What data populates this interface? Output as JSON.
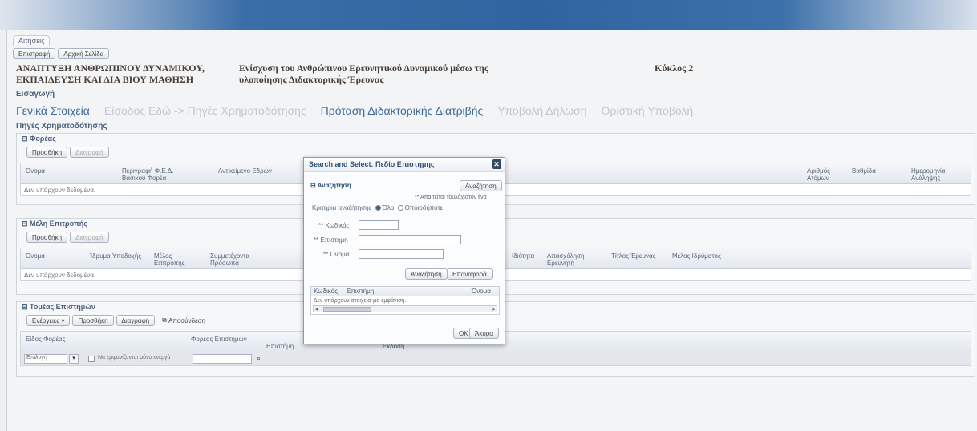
{
  "breadcrumb": {
    "tab": "Αιτήσεις"
  },
  "toolbar": {
    "btn1": "Επιστροφή",
    "btn2": "Αρχική Σελίδα"
  },
  "project": {
    "title": "ΑΝΑΠΤΥΞΗ ΑΝΘΡΩΠΙΝΟΥ ΔΥΝΑΜΙΚΟΥ, ΕΚΠΑΙΔΕΥΣΗ ΚΑΙ ΔΙΑ ΒΙΟΥ ΜΑΘΗΣΗ",
    "subtitle": "Ενίσχυση του Ανθρώπινου Ερευνητικού Δυναμικού μέσω της υλοποίησης Διδακτορικής Έρευνας",
    "code": "Κύκλος 2"
  },
  "intro_label": "Εισαγωγή",
  "steps": [
    {
      "label": "Γενικά Στοιχεία",
      "done": true
    },
    {
      "label": "Είσοδος Εδώ -> Πηγές Χρηματοδότησης",
      "done": false
    },
    {
      "label": "Πρόταση Διδακτορικής Διατριβής",
      "done": true
    },
    {
      "label": "Υποβολή Δήλωση",
      "done": false
    },
    {
      "label": "Οριστική Υποβολή",
      "done": false
    }
  ],
  "funding_title": "Πηγές Χρηματοδότησης",
  "section1": {
    "header": "Φορέας",
    "btn_add": "Προσθήκη",
    "btn_del": "Διαγραφή",
    "cols": [
      "Όνομα",
      "Περιγραφή Φ.Ε.Δ. Βασικού Φορέα",
      "Αντικείμενο Εδρών"
    ],
    "cols_right": [
      "Αριθμός Ατόμων",
      "Βαθμίδα",
      "Ημερομηνία Ανάληψης"
    ],
    "empty": "Δεν υπάρχουν δεδομένα."
  },
  "section2": {
    "header": "Μέλη Επιτροπής",
    "btn_add": "Προσθήκη",
    "btn_del": "Διαγραφή",
    "cols": [
      "Όνομα",
      "Ίδρυμα Υποδοχής",
      "Μέλος Επιτροπής",
      "Συμμετέχοντα Πρόσωπα"
    ],
    "cols_right": [
      "Ιδιότητα",
      "Απασχόληση Ερευνητή",
      "Τίτλος Έρευνας",
      "Μέλος Ιδρύματος"
    ],
    "empty": "Δεν υπάρχουν δεδομένα."
  },
  "section3": {
    "header": "Τομέας Επιστημών",
    "btn_actions": "Ενέργειες",
    "btn_add": "Προσθήκη",
    "btn_del": "Διαγραφή",
    "btn_detach": "Αποσύνδεση",
    "cols": [
      "Είδος Φορέας",
      "Φορέας Επιστημών",
      "Επιστήμη",
      "Έκδοση"
    ],
    "select_value": "Επιλογή",
    "checkbox_label": "Να εμφανίζονται μόνο ενεργά"
  },
  "modal": {
    "title": "Search and Select: Πεδίο Επιστήμης",
    "search_header": "Αναζήτηση",
    "search_go": "Αναζήτηση",
    "hint": "** Απαιτείται τουλάχιστον ένα",
    "criteria_label": "Κριτήρια αναζήτησης",
    "radio_all": "Όλα",
    "radio_any": "Οποιοδήποτε",
    "field_code": "** Κωδικός",
    "field_name": "** Επιστήμη",
    "field_type": "** Όνομα",
    "btn_search": "Αναζήτηση",
    "btn_clear": "Επαναφορά",
    "result_cols": [
      "Κωδικός",
      "Επιστήμη",
      "Όνομα"
    ],
    "result_empty": "Δεν υπάρχουν στοιχεία για εμφάνιση.",
    "btn_ok": "OK",
    "btn_cancel": "Άκυρο"
  }
}
